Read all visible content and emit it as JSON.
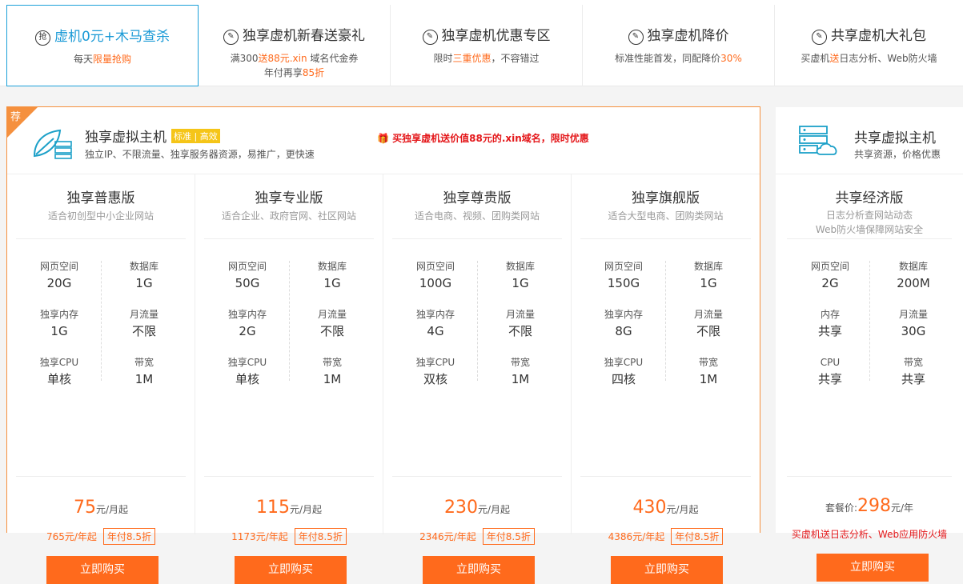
{
  "promo_tabs": [
    {
      "icon": "抢",
      "title": "虚机0元+木马查杀",
      "line1_pre": "每天",
      "line1_hl": "限量抢购",
      "line1_post": "",
      "line2_pre": "",
      "line2_hl": ""
    },
    {
      "icon": "✎",
      "title": "独享虚机新春送豪礼",
      "line1_pre": "满300",
      "line1_hl": "送88元.xin",
      "line1_post": " 域名代金券",
      "line2_pre": "年付再享",
      "line2_hl": "85折"
    },
    {
      "icon": "✎",
      "title": "独享虚机优惠专区",
      "line1_pre": "限时",
      "line1_hl": "三重优惠",
      "line1_post": "，不容错过",
      "line2_pre": "",
      "line2_hl": ""
    },
    {
      "icon": "✎",
      "title": "独享虚机降价",
      "line1_pre": "标准性能首发，同配降价",
      "line1_hl": "30%",
      "line1_post": "",
      "line2_pre": "",
      "line2_hl": ""
    },
    {
      "icon": "✎",
      "title": "共享虚机大礼包",
      "line1_pre": "买虚机",
      "line1_hl": "送",
      "line1_post": "日志分析、Web防火墙",
      "line2_pre": "",
      "line2_hl": ""
    }
  ],
  "main": {
    "badge": "荐",
    "title": "独享虚拟主机",
    "tag": "标准 | 高效",
    "desc": "独立IP、不限流量、独享服务器资源，易推广，更快速",
    "gift": "买独享虚机送价值88元的.xin域名，限时优惠",
    "plans": [
      {
        "name": "独享普惠版",
        "sub": "适合初创型中小企业网站",
        "specs": [
          [
            "网页空间",
            "20G"
          ],
          [
            "数据库",
            "1G"
          ],
          [
            "独享内存",
            "1G"
          ],
          [
            "月流量",
            "不限"
          ],
          [
            "独享CPU",
            "单核"
          ],
          [
            "带宽",
            "1M"
          ]
        ],
        "price": "75",
        "unit": "元/月起",
        "year": "765元/年起",
        "discount": "年付8.5折",
        "buy": "立即购买"
      },
      {
        "name": "独享专业版",
        "sub": "适合企业、政府官网、社区网站",
        "specs": [
          [
            "网页空间",
            "50G"
          ],
          [
            "数据库",
            "1G"
          ],
          [
            "独享内存",
            "2G"
          ],
          [
            "月流量",
            "不限"
          ],
          [
            "独享CPU",
            "单核"
          ],
          [
            "带宽",
            "1M"
          ]
        ],
        "price": "115",
        "unit": "元/月起",
        "year": "1173元/年起",
        "discount": "年付8.5折",
        "buy": "立即购买"
      },
      {
        "name": "独享尊贵版",
        "sub": "适合电商、视频、团购类网站",
        "specs": [
          [
            "网页空间",
            "100G"
          ],
          [
            "数据库",
            "1G"
          ],
          [
            "独享内存",
            "4G"
          ],
          [
            "月流量",
            "不限"
          ],
          [
            "独享CPU",
            "双核"
          ],
          [
            "带宽",
            "1M"
          ]
        ],
        "price": "230",
        "unit": "元/月起",
        "year": "2346元/年起",
        "discount": "年付8.5折",
        "buy": "立即购买"
      },
      {
        "name": "独享旗舰版",
        "sub": "适合大型电商、团购类网站",
        "specs": [
          [
            "网页空间",
            "150G"
          ],
          [
            "数据库",
            "1G"
          ],
          [
            "独享内存",
            "8G"
          ],
          [
            "月流量",
            "不限"
          ],
          [
            "独享CPU",
            "四核"
          ],
          [
            "带宽",
            "1M"
          ]
        ],
        "price": "430",
        "unit": "元/月起",
        "year": "4386元/年起",
        "discount": "年付8.5折",
        "buy": "立即购买"
      }
    ]
  },
  "side": {
    "title": "共享虚拟主机",
    "desc": "共享资源，价格优惠",
    "plan": {
      "name": "共享经济版",
      "sub1": "日志分析查网站动态",
      "sub2": "Web防火墙保障网站安全",
      "specs": [
        [
          "网页空间",
          "2G"
        ],
        [
          "数据库",
          "200M"
        ],
        [
          "内存",
          "共享"
        ],
        [
          "月流量",
          "30G"
        ],
        [
          "CPU",
          "共享"
        ],
        [
          "带宽",
          "共享"
        ]
      ],
      "price_pre": "套餐价:",
      "price": "298",
      "unit": "元/年",
      "gift": "买虚机送日志分析、Web应用防火墙",
      "buy": "立即购买"
    }
  },
  "colors": {
    "accent": "#ff6a1c",
    "border": "#f5903e",
    "link": "#1b9ad6",
    "tag": "#f5c518",
    "gift": "#e4181b"
  }
}
